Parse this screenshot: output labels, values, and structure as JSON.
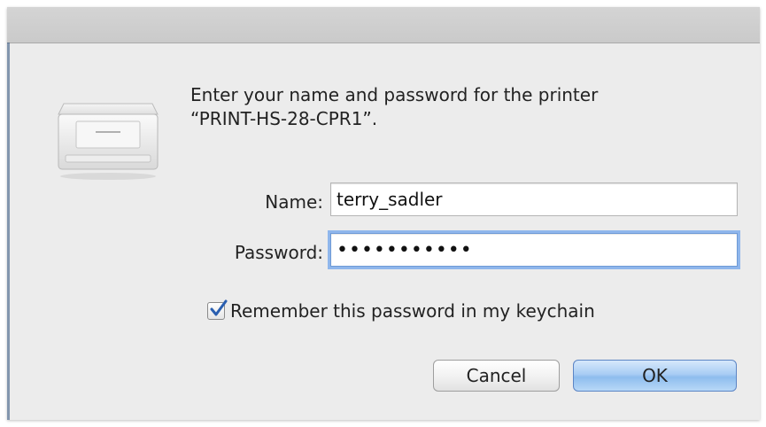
{
  "dialog": {
    "message_line1": "Enter your name and password for the printer",
    "message_line2": "“PRINT-HS-28-CPR1”.",
    "icon": "printer-icon"
  },
  "fields": {
    "name_label": "Name:",
    "name_value": "terry_sadler",
    "password_label": "Password:",
    "password_value": "•••••••••••"
  },
  "keychain": {
    "checked": true,
    "label": "Remember this password in my keychain"
  },
  "buttons": {
    "cancel_label": "Cancel",
    "ok_label": "OK"
  },
  "colors": {
    "focus_ring": "#8fb6ec",
    "default_button": "#a9cdf4",
    "checkmark": "#2a5fb0"
  }
}
